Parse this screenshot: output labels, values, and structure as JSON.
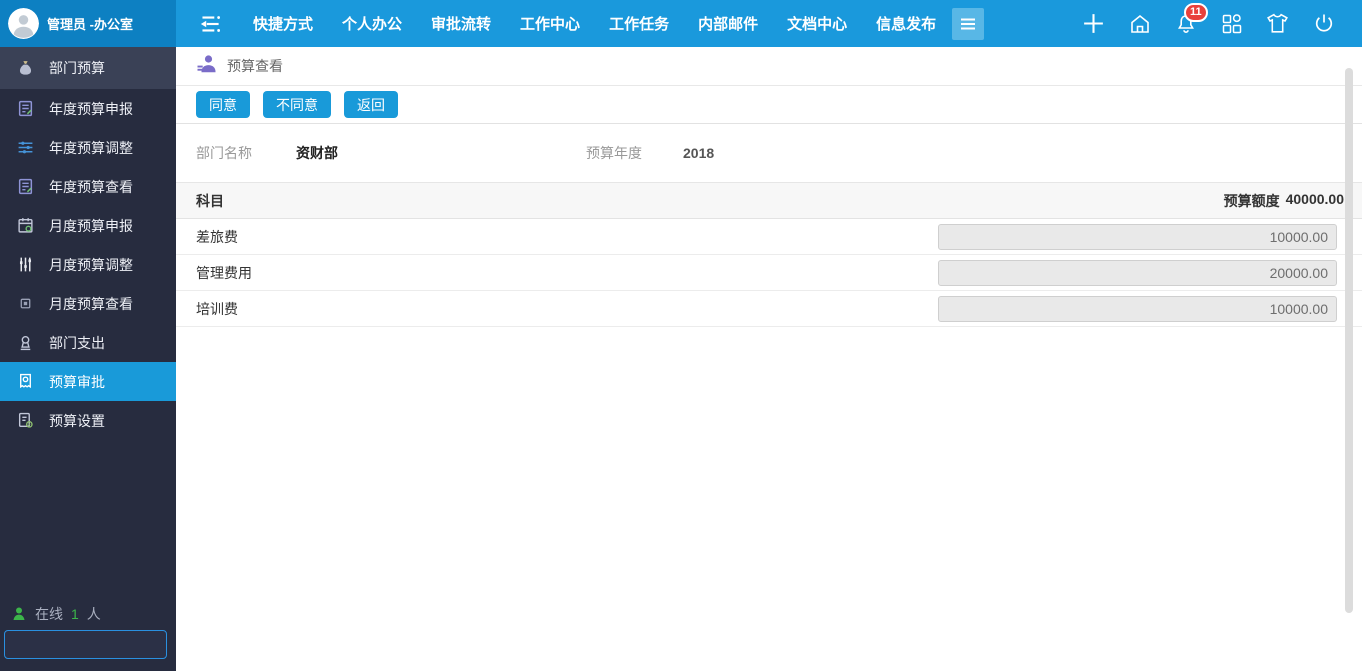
{
  "topbar": {
    "user_name": "管理员 -办公室",
    "nav_items": [
      "快捷方式",
      "个人办公",
      "审批流转",
      "工作中心",
      "工作任务",
      "内部邮件",
      "文档中心",
      "信息发布"
    ],
    "notification_count": "11",
    "right_icons": [
      "add-icon",
      "home-icon",
      "notifications-bell-icon",
      "apps-grid-icon",
      "theme-shirt-icon",
      "power-icon"
    ]
  },
  "sidebar": {
    "items": [
      {
        "label": "部门预算",
        "icon": "money-bag-icon"
      },
      {
        "label": "年度预算申报",
        "icon": "annual-declare-form-icon"
      },
      {
        "label": "年度预算调整",
        "icon": "sliders-horizontal-icon"
      },
      {
        "label": "年度预算查看",
        "icon": "annual-view-form-icon"
      },
      {
        "label": "月度预算申报",
        "icon": "monthly-declare-calendar-icon"
      },
      {
        "label": "月度预算调整",
        "icon": "sliders-vertical-icon"
      },
      {
        "label": "月度预算查看",
        "icon": "monthly-view-icon"
      },
      {
        "label": "部门支出",
        "icon": "dept-expense-stamp-icon"
      },
      {
        "label": "预算审批",
        "icon": "budget-approval-receipt-icon"
      },
      {
        "label": "预算设置",
        "icon": "budget-settings-icon"
      }
    ],
    "online_label": "在线",
    "online_count": "1",
    "online_unit": "人"
  },
  "main": {
    "page_title": "预算查看",
    "buttons": {
      "agree": "同意",
      "disagree": "不同意",
      "back": "返回"
    },
    "form": {
      "department_label": "部门名称",
      "department_value": "资财部",
      "year_label": "预算年度",
      "year_value": "2018"
    },
    "table": {
      "subject_header": "科目",
      "budget_quota_label": "预算额度",
      "budget_quota_value": "40000.00",
      "rows": [
        {
          "subject": "差旅费",
          "amount": "10000.00"
        },
        {
          "subject": "管理费用",
          "amount": "20000.00"
        },
        {
          "subject": "培训费",
          "amount": "10000.00"
        }
      ]
    }
  },
  "colors": {
    "topbar_blue": "#1a99dc",
    "topbar_user_blue": "#0d80c2",
    "sidebar_dark": "#272c3f",
    "active_item_blue": "#199ad9",
    "badge_red": "#e8413c",
    "online_green": "#3cb54a",
    "title_icon_purple": "#7a6cc8"
  }
}
